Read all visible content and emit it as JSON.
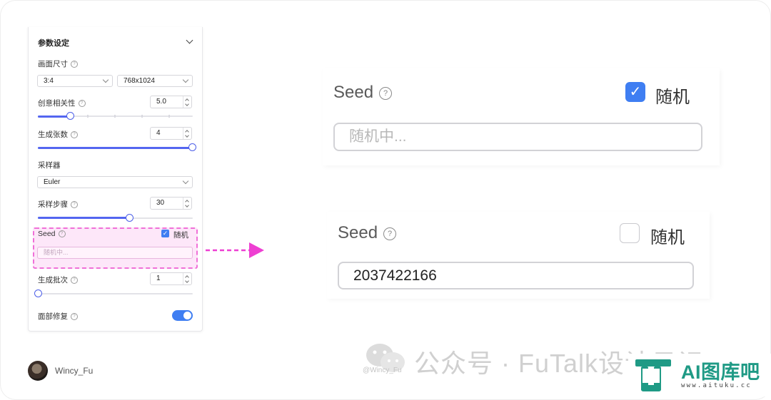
{
  "settings_panel": {
    "title": "参数设定",
    "canvas_size": {
      "label": "画面尺寸",
      "ratio_value": "3:4",
      "resolution_value": "768x1024"
    },
    "creativity": {
      "label": "创意相关性",
      "value": "5.0",
      "slider_fraction": 0.18
    },
    "image_count": {
      "label": "生成张数",
      "value": "4",
      "slider_fraction": 1.0
    },
    "sampler": {
      "label": "采样器",
      "value": "Euler"
    },
    "sampling_steps": {
      "label": "采样步骤",
      "value": "30",
      "slider_fraction": 0.59
    },
    "seed": {
      "label": "Seed",
      "random_label": "随机",
      "random_checked": true,
      "placeholder": "随机中..."
    },
    "batch_count": {
      "label": "生成批次",
      "value": "1",
      "slider_fraction": 0.0
    },
    "face_restore": {
      "label": "面部修复",
      "enabled": true
    }
  },
  "zoom_checked": {
    "seed_label": "Seed",
    "random_label": "随机",
    "random_checked": true,
    "placeholder": "随机中..."
  },
  "zoom_unchecked": {
    "seed_label": "Seed",
    "random_label": "随机",
    "random_checked": false,
    "value": "2037422166"
  },
  "footer": {
    "author": "Wincy_Fu",
    "watermark": "公众号 · FuTalk设计日记",
    "watermark_handle": "@Wincy_Fu",
    "logo_text": "AI图库吧",
    "logo_url": "www.aituku.cc"
  },
  "colors": {
    "accent": "#3f7ef2",
    "slider": "#5466f0",
    "highlight_border": "#f070d8",
    "arrow": "#ee3fd2",
    "logo": "#1f9a85"
  }
}
